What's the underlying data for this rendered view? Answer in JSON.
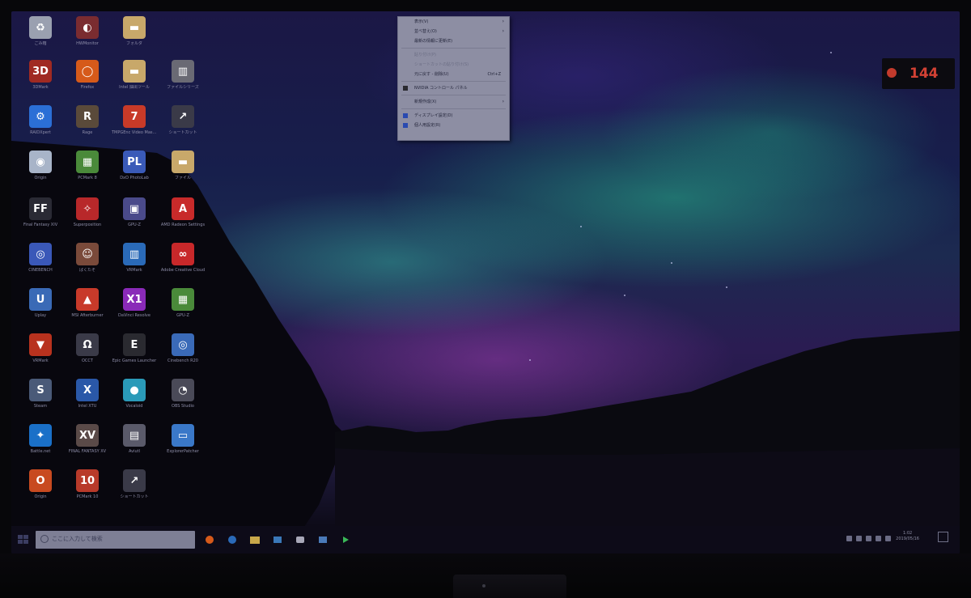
{
  "desktop": {
    "icons": [
      {
        "label": "ごみ箱",
        "icon": "recycle-bin-icon",
        "color": "#9aa0b0"
      },
      {
        "label": "3DMark",
        "icon": "3dmark-icon",
        "color": "#a02a22"
      },
      {
        "label": "RAIDXpert",
        "icon": "settings-gear-icon",
        "color": "#2b6fd6"
      },
      {
        "label": "Origin",
        "icon": "origin-icon",
        "color": "#a8b4c8"
      },
      {
        "label": "Final Fantasy XIV",
        "icon": "ff-icon",
        "color": "#2a2a34"
      },
      {
        "label": "CINEBENCH",
        "icon": "cinebench-icon",
        "color": "#3a58b8"
      },
      {
        "label": "Uplay",
        "icon": "uplay-icon",
        "color": "#3a6ab6"
      },
      {
        "label": "VRMark",
        "icon": "vrmark-icon",
        "color": "#b8321e"
      },
      {
        "label": "Steam",
        "icon": "steam-icon",
        "color": "#4a5a78"
      },
      {
        "label": "Battle.net",
        "icon": "battlenet-icon",
        "color": "#1a70c8"
      },
      {
        "label": "Origin",
        "icon": "origin-icon",
        "color": "#c84a20"
      },
      {
        "label": "HWMonitor",
        "icon": "hwmonitor-icon",
        "color": "#7a2c30"
      },
      {
        "label": "Firefox",
        "icon": "firefox-icon",
        "color": "#d65a1a"
      },
      {
        "label": "Rage",
        "icon": "app-icon",
        "color": "#5a4a3a"
      },
      {
        "label": "PCMark 8",
        "icon": "pcmark-icon",
        "color": "#4a8a3a"
      },
      {
        "label": "Superposition",
        "icon": "superposition-icon",
        "color": "#b8282a"
      },
      {
        "label": "ぱくたそ",
        "icon": "app-icon",
        "color": "#7a4a3a"
      },
      {
        "label": "MSI Afterburner",
        "icon": "afterburner-icon",
        "color": "#c83a2a"
      },
      {
        "label": "OCCT",
        "icon": "occt-icon",
        "color": "#3a3a48"
      },
      {
        "label": "Intel XTU",
        "icon": "xtu-icon",
        "color": "#2a58a8"
      },
      {
        "label": "FINAL FANTASY XV",
        "icon": "ffxv-icon",
        "color": "#5a4a48"
      },
      {
        "label": "PCMark 10",
        "icon": "pcmark10-icon",
        "color": "#b83a2a"
      },
      {
        "label": "フォルダ",
        "icon": "folder-icon",
        "color": "#c8a86a"
      },
      {
        "label": "Intel 抽出ツール",
        "icon": "folder-icon",
        "color": "#c8a86a"
      },
      {
        "label": "TMPGEnc Video Mastering Works 7",
        "icon": "tmpgenc-icon",
        "color": "#c83a28"
      },
      {
        "label": "DxO PhotoLab",
        "icon": "dxo-icon",
        "color": "#3a5ab8"
      },
      {
        "label": "GPU-Z",
        "icon": "gpuz-icon",
        "color": "#4a4a8a"
      },
      {
        "label": "VRMark",
        "icon": "vrmark2-icon",
        "color": "#2a6ab8"
      },
      {
        "label": "DaVinci Resolve",
        "icon": "resolve-icon",
        "color": "#8a2ab8"
      },
      {
        "label": "Epic Games Launcher",
        "icon": "epic-icon",
        "color": "#2a2a30"
      },
      {
        "label": "Vocaloid",
        "icon": "vocaloid-icon",
        "color": "#2a9ab8"
      },
      {
        "label": "Aviutl",
        "icon": "aviutl-icon",
        "color": "#5a5a6a"
      },
      {
        "label": "ショートカット",
        "icon": "shortcut-icon",
        "color": "#3a3a48"
      },
      {
        "label": "ファイルシリーズ",
        "icon": "film-icon",
        "color": "#6a6a74"
      },
      {
        "label": "ショートカット",
        "icon": "shortcut-icon",
        "color": "#3a3a48"
      },
      {
        "label": "ファイル",
        "icon": "folder-icon",
        "color": "#c8a86a"
      },
      {
        "label": "AMD Radeon Settings",
        "icon": "amd-icon",
        "color": "#c82a2a"
      },
      {
        "label": "Adobe Creative Cloud",
        "icon": "adobe-icon",
        "color": "#c8282a"
      },
      {
        "label": "GPU-Z",
        "icon": "gpuz2-icon",
        "color": "#4a8a3a"
      },
      {
        "label": "Cinebench R20",
        "icon": "cinebench2-icon",
        "color": "#3a6ab8"
      },
      {
        "label": "OBS Studio",
        "icon": "obs-icon",
        "color": "#4a4a58"
      },
      {
        "label": "ExplorerPatcher",
        "icon": "explorer-icon",
        "color": "#3a78c8"
      }
    ]
  },
  "context_menu": {
    "items": [
      {
        "label": "表示(V)",
        "type": "submenu"
      },
      {
        "label": "並べ替え(O)",
        "type": "submenu"
      },
      {
        "label": "最新の情報に更新(E)",
        "type": "normal"
      },
      {
        "type": "separator"
      },
      {
        "label": "貼り付け(P)",
        "type": "disabled"
      },
      {
        "label": "ショートカットの貼り付け(S)",
        "type": "disabled"
      },
      {
        "label": "元に戻す - 削除(U)",
        "type": "shortcut",
        "shortcut": "Ctrl+Z"
      },
      {
        "type": "separator"
      },
      {
        "label": "NVIDIA コントロール パネル",
        "type": "icon",
        "icon": "nvidia-icon"
      },
      {
        "type": "separator"
      },
      {
        "label": "新規作成(X)",
        "type": "submenu"
      },
      {
        "type": "separator"
      },
      {
        "label": "ディスプレイ設定(D)",
        "type": "icon",
        "icon": "display-icon"
      },
      {
        "label": "個人用設定(R)",
        "type": "icon",
        "icon": "personalize-icon"
      }
    ]
  },
  "fps_counter": {
    "value": "144"
  },
  "taskbar": {
    "search_placeholder": "ここに入力して検索",
    "pinned_apps": [
      {
        "name": "firefox-taskbar-icon",
        "color": "#d65a1a"
      },
      {
        "name": "edge-taskbar-icon",
        "color": "#2a6ab8"
      },
      {
        "name": "file-explorer-taskbar-icon",
        "color": "#c8a84a"
      },
      {
        "name": "app-taskbar-icon",
        "color": "#3a78b8"
      },
      {
        "name": "chat-taskbar-icon",
        "color": "#a8a8b8"
      },
      {
        "name": "store-taskbar-icon",
        "color": "#4a7ab8"
      },
      {
        "name": "play-taskbar-icon",
        "color": "#3ab858"
      }
    ],
    "clock_time": "1:02",
    "clock_date": "2019/05/16"
  }
}
